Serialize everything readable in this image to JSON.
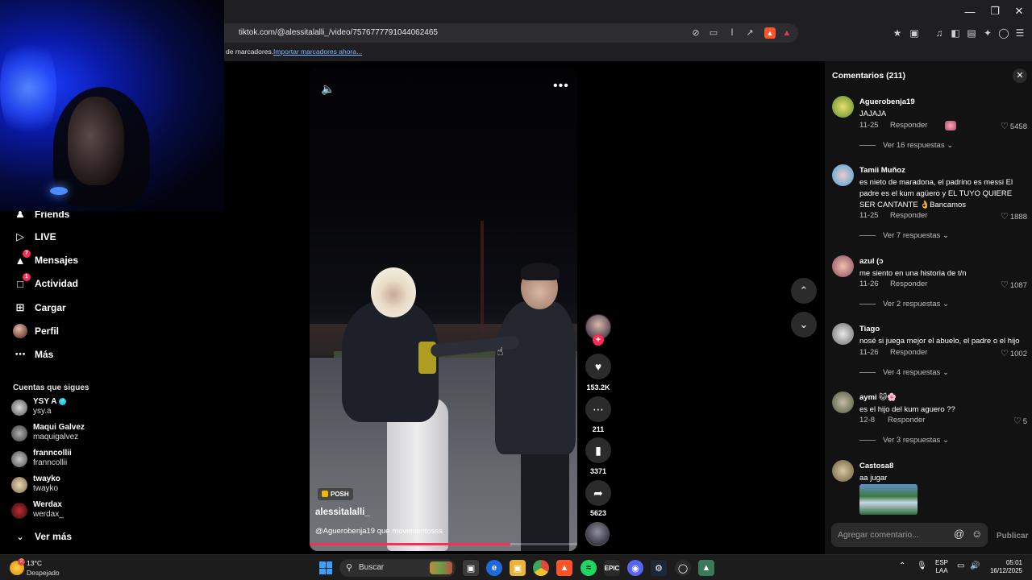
{
  "browser": {
    "url": "tiktok.com/@alessitalalli_/video/7576777791044062465",
    "bookmarks_text": "de marcadores.",
    "bookmarks_link": "Importar marcadores ahora..."
  },
  "sidebar": {
    "items": [
      {
        "label": "Friends",
        "icon": "friends-icon"
      },
      {
        "label": "LIVE",
        "icon": "live-icon"
      },
      {
        "label": "Mensajes",
        "icon": "messages-icon",
        "badge": "7"
      },
      {
        "label": "Actividad",
        "icon": "activity-icon",
        "badge": "1"
      },
      {
        "label": "Cargar",
        "icon": "upload-icon"
      },
      {
        "label": "Perfil",
        "icon": "profile-avatar"
      },
      {
        "label": "Más",
        "icon": "more-icon"
      }
    ],
    "following_title": "Cuentas que sigues",
    "accounts": [
      {
        "name": "YSY A",
        "handle": "ysy.a",
        "verified": true
      },
      {
        "name": "Maqui Galvez",
        "handle": "maquigalvez"
      },
      {
        "name": "franncollii",
        "handle": "franncollii"
      },
      {
        "name": "twayko",
        "handle": "twayko"
      },
      {
        "name": "Werdax",
        "handle": "werdax_"
      }
    ],
    "see_more": "Ver más"
  },
  "video": {
    "tag": "POSH",
    "author": "alessitalalli_",
    "caption": "@Aguerobenja19 que movimientosss",
    "progress": 0.75,
    "likes": "153.2K",
    "comments": "211",
    "saves": "3371",
    "shares": "5623"
  },
  "comments_panel": {
    "title": "Comentarios (211)",
    "input_placeholder": "Agregar comentario...",
    "publish": "Publicar",
    "reply_label": "Responder",
    "comments": [
      {
        "user": "Aguerobenja19",
        "text": "JAJAJA",
        "date": "11-25",
        "likes": "5458",
        "replies": "Ver 16 respuestas"
      },
      {
        "user": "Tamii Muñoz",
        "text": "es nieto de maradona, el padrino es messi El padre es el kum agüero y EL TUYO QUIERE SER CANTANTE 👌Bancamos",
        "date": "11-25",
        "likes": "1888",
        "replies": "Ver 7 respuestas"
      },
      {
        "user": "azul (ɔ",
        "text": "me siento en una historia de t/n",
        "date": "11-26",
        "likes": "1087",
        "replies": "Ver 2 respuestas"
      },
      {
        "user": "Tiago",
        "text": "nosé si juega mejor el abuelo, el padre o el hijo",
        "date": "11-26",
        "likes": "1002",
        "replies": "Ver 4 respuestas"
      },
      {
        "user": "aymi 🐱🌸",
        "text": "es el hijo del kum aguero ??",
        "date": "12-8",
        "likes": "5",
        "replies": "Ver 3 respuestas"
      },
      {
        "user": "Castosa8",
        "text": "aa jugar"
      }
    ]
  },
  "taskbar": {
    "temp": "13°C",
    "weather": "Despejado",
    "weather_badge": "2",
    "search": "Buscar",
    "lang_top": "ESP",
    "lang_bottom": "LAA",
    "time": "05:01",
    "date": "16/12/2025"
  },
  "colors": {
    "accent": "#fe2c55",
    "panel": "#121212",
    "taskbar": "#1c1c1c"
  }
}
